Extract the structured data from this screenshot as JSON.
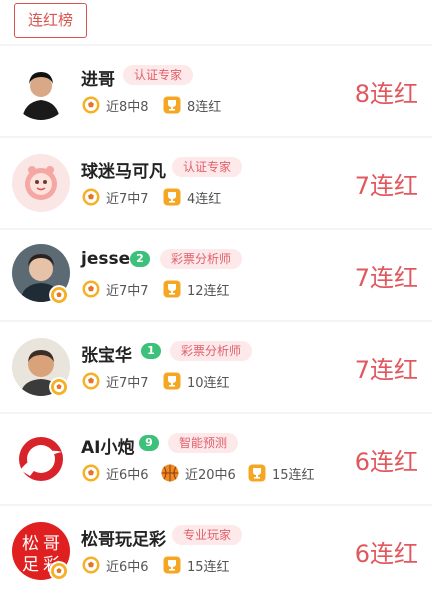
{
  "tabs": {
    "active_label": "连红榜"
  },
  "experts": [
    {
      "name": "进哥",
      "level": "",
      "tag": "认证专家",
      "stats": [
        "近8中8",
        "8连红"
      ],
      "streak": "8连红"
    },
    {
      "name": "球迷马可凡",
      "level": "",
      "tag": "认证专家",
      "stats": [
        "近7中7",
        "4连红"
      ],
      "streak": "7连红"
    },
    {
      "name": "jesse",
      "level": "2",
      "tag": "彩票分析师",
      "stats": [
        "近7中7",
        "12连红"
      ],
      "streak": "7连红"
    },
    {
      "name": "张宝华",
      "level": "1",
      "tag": "彩票分析师",
      "stats": [
        "近7中7",
        "10连红"
      ],
      "streak": "7连红"
    },
    {
      "name": "AI小炮",
      "level": "9",
      "tag": "智能预测",
      "stats": [
        "近6中6",
        "近20中6",
        "15连红"
      ],
      "streak": "6连红"
    },
    {
      "name": "松哥玩足彩",
      "level": "",
      "tag": "专业玩家",
      "stats": [
        "近6中6",
        "15连红"
      ],
      "streak": "6连红",
      "avatar_text": [
        "松",
        "哥",
        "足",
        "彩"
      ]
    }
  ],
  "icons": {
    "football": "football-icon",
    "basketball": "basketball-icon",
    "trophy": "trophy-icon"
  },
  "colors": {
    "accent": "#e0585e",
    "tag_bg": "#fde8ea",
    "level_badge": "#3cc17a"
  }
}
